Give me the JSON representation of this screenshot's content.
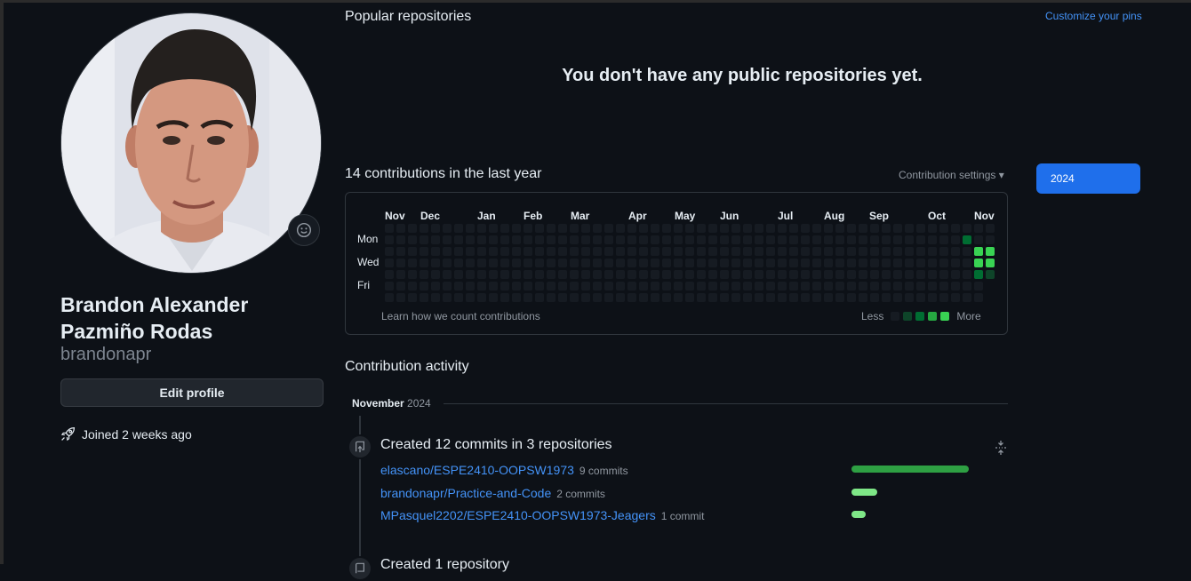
{
  "profile": {
    "full_name": "Brandon Alexander Pazmiño Rodas",
    "username": "brandonapr",
    "edit_label": "Edit profile",
    "joined": "Joined 2 weeks ago"
  },
  "popular": {
    "title": "Popular repositories",
    "customize": "Customize your pins",
    "empty": "You don't have any public repositories yet."
  },
  "contributions": {
    "title": "14 contributions in the last year",
    "settings": "Contribution settings ▾",
    "months": [
      "Nov",
      "Dec",
      "Jan",
      "Feb",
      "Mar",
      "Apr",
      "May",
      "Jun",
      "Jul",
      "Aug",
      "Sep",
      "Oct",
      "Nov"
    ],
    "days": [
      "Mon",
      "Wed",
      "Fri"
    ],
    "learn": "Learn how we count contributions",
    "less": "Less",
    "more": "More",
    "colors": [
      "#161b22",
      "#0e4429",
      "#006d32",
      "#26a641",
      "#39d353"
    ],
    "active_cells": [
      {
        "week": 50,
        "day": 1,
        "level": 2
      },
      {
        "week": 51,
        "day": 2,
        "level": 4
      },
      {
        "week": 51,
        "day": 3,
        "level": 4
      },
      {
        "week": 51,
        "day": 4,
        "level": 2
      },
      {
        "week": 52,
        "day": 2,
        "level": 4
      },
      {
        "week": 52,
        "day": 3,
        "level": 4
      },
      {
        "week": 52,
        "day": 4,
        "level": 1
      }
    ],
    "year": "2024"
  },
  "activity": {
    "title": "Contribution activity",
    "month": "November",
    "year": "2024",
    "commits_title": "Created 12 commits in 3 repositories",
    "repos": [
      {
        "name": "elascano/ESPE2410-OOPSW1973",
        "count": "9 commits",
        "share": 1.0,
        "color": "#2ea043"
      },
      {
        "name": "brandonapr/Practice-and-Code",
        "count": "2 commits",
        "share": 0.22,
        "color": "#7ee787"
      },
      {
        "name": "MPasquel2202/ESPE2410-OOPSW1973-Jeagers",
        "count": "1 commit",
        "share": 0.11,
        "color": "#7ee787"
      }
    ],
    "next_title": "Created 1 repository"
  }
}
